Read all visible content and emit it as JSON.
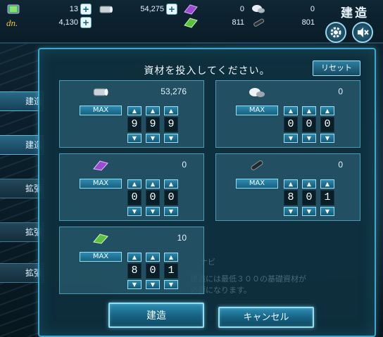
{
  "resources": {
    "fuel": {
      "value": "13",
      "icon": "fuel-icon"
    },
    "ammo": {
      "value": "54,275",
      "icon": "ammo-icon"
    },
    "steel": {
      "value": "0",
      "icon": "steel-icon"
    },
    "bauxite": {
      "value": "0",
      "icon": "bauxite-icon"
    },
    "dev_material": {
      "value": "4,130",
      "icon": "dev-material-icon"
    },
    "instant_build": {
      "value": "811",
      "icon": "instant-build-icon"
    },
    "screw": {
      "value": "801",
      "icon": "screw-icon"
    }
  },
  "header": {
    "title": "建造"
  },
  "sidebar": {
    "tabs": [
      "建造",
      "建造",
      "拡張",
      "拡張",
      "拡張"
    ]
  },
  "dialog": {
    "title": "資材を投入してください。",
    "reset_label": "リセット",
    "max_label": "MAX",
    "up_arrow": "▲",
    "down_arrow": "▼",
    "materials": [
      {
        "name": "ammo",
        "icon": "ammo-icon",
        "amount": "53,276",
        "digits": [
          "9",
          "9",
          "9"
        ]
      },
      {
        "name": "bauxite",
        "icon": "bauxite-icon",
        "amount": "0",
        "digits": [
          "0",
          "0",
          "0"
        ]
      },
      {
        "name": "steel",
        "icon": "steel-icon",
        "amount": "0",
        "digits": [
          "0",
          "0",
          "0"
        ]
      },
      {
        "name": "screw",
        "icon": "screw-icon",
        "amount": "0",
        "digits": [
          "8",
          "0",
          "1"
        ]
      },
      {
        "name": "instant_build",
        "icon": "instant-build-icon",
        "amount": "10",
        "digits": [
          "8",
          "0",
          "1"
        ]
      }
    ],
    "build_label": "建造",
    "cancel_label": "キャンセル"
  },
  "background_text": {
    "line1": "ナビ",
    "line2": "建造には最低３００の基礎資材が",
    "line3": "必要になります。"
  },
  "colors": {
    "accent": "#3fa7c9",
    "panel_bg": "#0e303e",
    "card_bg": "#265668",
    "button": "#2b8db3"
  }
}
